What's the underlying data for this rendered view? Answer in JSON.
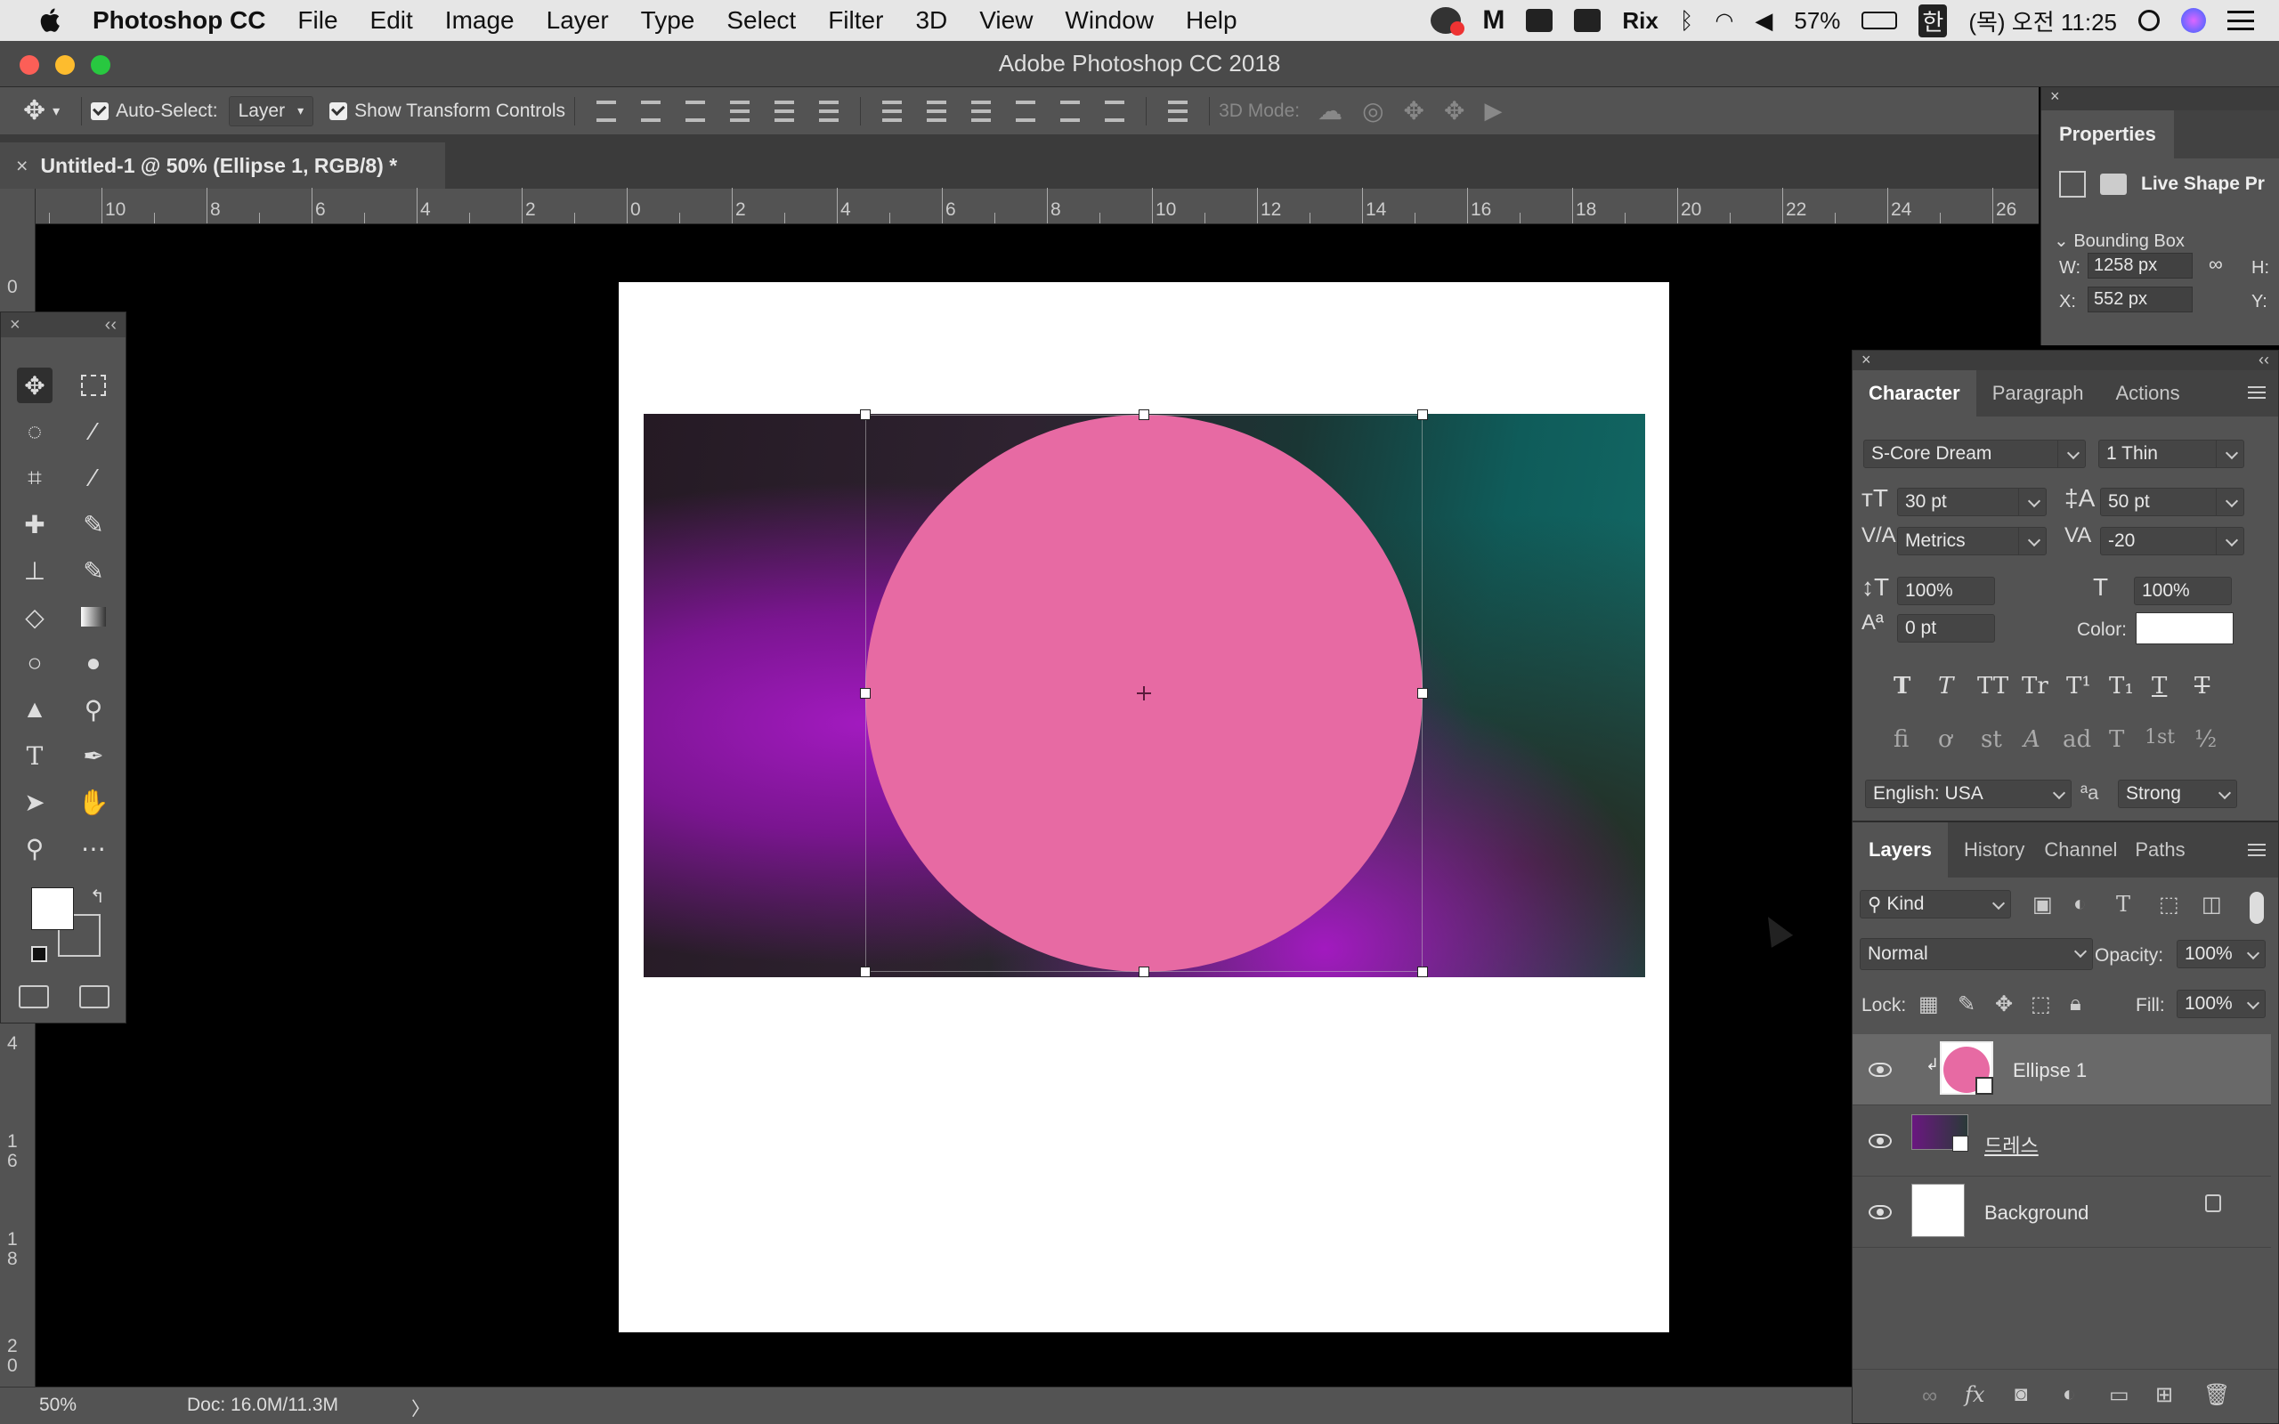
{
  "menubar": {
    "app": "Photoshop CC",
    "items": [
      "File",
      "Edit",
      "Image",
      "Layer",
      "Type",
      "Select",
      "Filter",
      "3D",
      "View",
      "Window",
      "Help"
    ],
    "rix": "Rix",
    "battery": "57%",
    "input_method": "한",
    "clock": "(목) 오전 11:25"
  },
  "window": {
    "title": "Adobe Photoshop CC 2018"
  },
  "options": {
    "auto_select_label": "Auto-Select:",
    "auto_select_value": "Layer",
    "show_transform_label": "Show Transform Controls",
    "mode_3d_label": "3D Mode:"
  },
  "document": {
    "tab_title": "Untitled-1 @ 50% (Ellipse 1, RGB/8) *",
    "close": "×"
  },
  "rulers": {
    "h_labels": [
      "10",
      "8",
      "6",
      "4",
      "2",
      "0",
      "2",
      "4",
      "6",
      "8",
      "10",
      "12",
      "14",
      "16",
      "18",
      "20",
      "22",
      "24",
      "26"
    ],
    "v_labels": [
      "0",
      "4",
      "1\n6",
      "1\n8",
      "2\n0"
    ]
  },
  "status": {
    "zoom": "50%",
    "doc": "Doc: 16.0M/11.3M",
    "arrow": "〉"
  },
  "properties": {
    "title": "Properties",
    "subtitle": "Live Shape Pr",
    "section": "Bounding Box",
    "w_label": "W:",
    "w_value": "1258 px",
    "h_label": "H:",
    "x_label": "X:",
    "x_value": "552 px",
    "y_label": "Y:"
  },
  "character": {
    "tabs": [
      "Character",
      "Paragraph",
      "Actions"
    ],
    "font_family": "S-Core Dream",
    "font_style": "1 Thin",
    "size": "30 pt",
    "leading": "50 pt",
    "kerning": "Metrics",
    "tracking": "-20",
    "vscale": "100%",
    "hscale": "100%",
    "baseline": "0 pt",
    "color_label": "Color:",
    "color": "#ffffff",
    "language": "English: USA",
    "aa_label": "ªa",
    "antialias": "Strong",
    "type_buttons": [
      "T",
      "T",
      "TT",
      "Tr",
      "T¹",
      "T₁",
      "T",
      "T"
    ],
    "opentype_buttons": [
      "fi",
      "ơ",
      "st",
      "A",
      "ad",
      "T",
      "1st",
      "½"
    ]
  },
  "layers": {
    "tabs": [
      "Layers",
      "History",
      "Channel",
      "Paths"
    ],
    "filter_kind": "Kind",
    "blend_mode": "Normal",
    "opacity_label": "Opacity:",
    "opacity": "100%",
    "lock_label": "Lock:",
    "fill_label": "Fill:",
    "fill": "100%",
    "items": [
      {
        "name": "Ellipse 1",
        "selected": true
      },
      {
        "name": "드레스",
        "selected": false
      },
      {
        "name": "Background",
        "selected": false
      }
    ]
  },
  "colors": {
    "ellipse": "#e76aa3",
    "ui_bg": "#535353",
    "selection": "#696969"
  }
}
